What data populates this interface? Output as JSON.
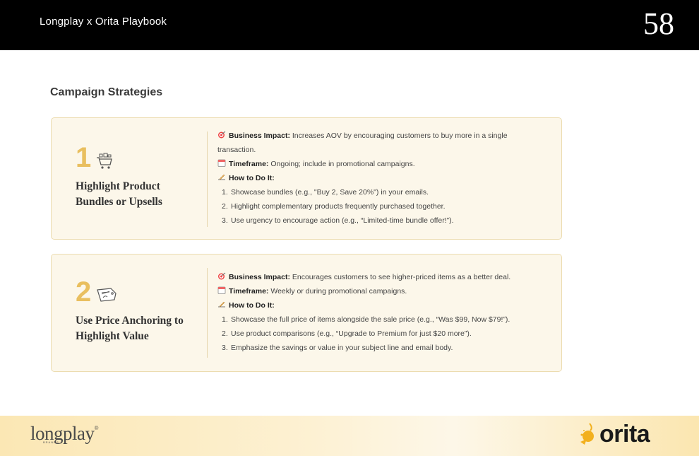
{
  "header": {
    "title": "Longplay x Orita Playbook",
    "page_number": "58"
  },
  "section_title": "Campaign Strategies",
  "cards": [
    {
      "number": "1",
      "icon": "shopping-cart-icon",
      "heading": "Highlight Product Bundles or Upsells",
      "impact_label": "Business Impact:",
      "impact_text": "Increases AOV by encouraging customers to buy more in a single transaction.",
      "timeframe_label": "Timeframe:",
      "timeframe_text": "Ongoing; include in promotional campaigns.",
      "howto_label": "How to Do It:",
      "steps": [
        {
          "n": "1.",
          "text": "Showcase bundles (e.g., \"Buy 2, Save 20%\") in your emails."
        },
        {
          "n": "2.",
          "text": "Highlight complementary products frequently purchased together."
        },
        {
          "n": "3.",
          "text": "Use urgency to encourage action (e.g., “Limited-time bundle offer!”)."
        }
      ]
    },
    {
      "number": "2",
      "icon": "price-tag-icon",
      "heading": "Use Price Anchoring to Highlight Value",
      "impact_label": "Business Impact:",
      "impact_text": "Encourages customers to see higher-priced items as a better deal.",
      "timeframe_label": "Timeframe:",
      "timeframe_text": "Weekly or during promotional campaigns.",
      "howto_label": "How to Do It:",
      "steps": [
        {
          "n": "1.",
          "text": "Showcase the full price of items alongside the sale price (e.g., “Was $99, Now $79!”)."
        },
        {
          "n": "2.",
          "text": "Use product comparisons (e.g., “Upgrade to Premium for just $20 more”)."
        },
        {
          "n": "3.",
          "text": "Emphasize the savings or value in your subject line and email body."
        }
      ]
    }
  ],
  "footer": {
    "left_logo": "longplay",
    "left_logo_mark": "®",
    "left_logo_sub": "BRANDS",
    "right_logo": "orita"
  },
  "colors": {
    "accent": "#e9bf5f",
    "card_bg": "#fcf7ea",
    "card_border": "#ecdcb0",
    "topbar": "#000000"
  }
}
